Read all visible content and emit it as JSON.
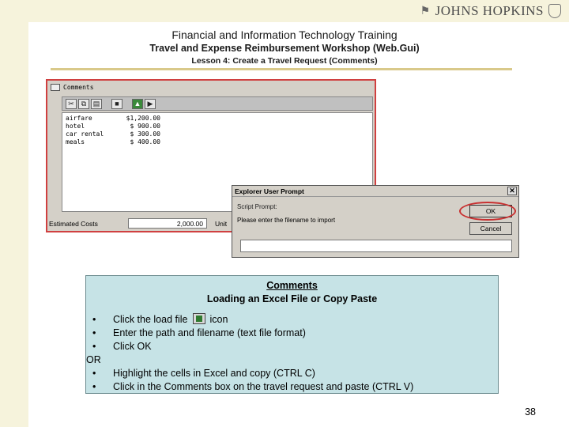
{
  "header": {
    "logo": "JOHNS HOPKINS",
    "title": "Financial and Information Technology Training",
    "subtitle": "Travel and Expense Reimbursement Workshop (Web.Gui)",
    "lesson": "Lesson 4: Create a Travel Request (Comments)"
  },
  "comments_window": {
    "title": "Comments",
    "rows": [
      {
        "category": "airfare",
        "amount": "$1,200.00"
      },
      {
        "category": "hotel",
        "amount": "$ 900.00"
      },
      {
        "category": "car rental",
        "amount": "$ 300.00"
      },
      {
        "category": "meals",
        "amount": "$ 400.00"
      }
    ],
    "estimated_costs_label": "Estimated Costs",
    "estimated_costs_value": "2,000.00",
    "unit_label": "Unit"
  },
  "prompt_dialog": {
    "title": "Explorer User Prompt",
    "caption": "Script Prompt:",
    "message": "Please enter the filename to import",
    "ok_label": "OK",
    "cancel_label": "Cancel",
    "input_value": ""
  },
  "info_box": {
    "title": "Comments",
    "subtitle": "Loading an Excel File or Copy Paste",
    "bullet_symbol": "•",
    "bullet1_before": "Click the load file",
    "bullet1_after": "icon",
    "bullet2": "Enter the path and filename (text file format)",
    "bullet3": "Click OK",
    "or_label": "OR",
    "bullet4": "Highlight the cells in Excel and copy (CTRL C)",
    "bullet5": "Click in the Comments box on the travel request and paste (CTRL V)"
  },
  "page_number": "38",
  "colors": {
    "band": "#f6f3dc",
    "rule": "#d9c98a",
    "info_background": "#c6e3e6",
    "highlight": "#c83030"
  },
  "icons": [
    "cut-icon",
    "copy-icon",
    "paste-icon",
    "save-icon",
    "load-file-icon",
    "close-icon"
  ]
}
